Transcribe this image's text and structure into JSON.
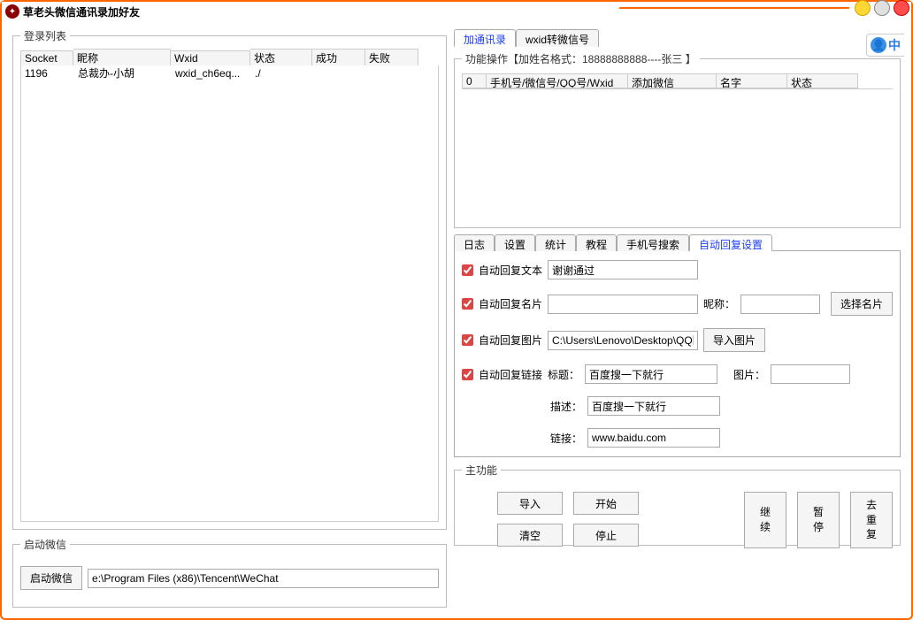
{
  "window": {
    "title": "草老头微信通讯录加好友"
  },
  "left": {
    "login_list_legend": "登录列表",
    "columns": {
      "socket": "Socket",
      "nick": "眤称",
      "wxid": "Wxid",
      "status": "状态",
      "success": "成功",
      "fail": "失败"
    },
    "rows": [
      {
        "socket": "1196",
        "nick": "总裁办-小胡",
        "wxid": "wxid_ch6eq...",
        "status": "./",
        "success": "",
        "fail": ""
      }
    ],
    "start_wechat_legend": "启动微信",
    "start_wechat_btn": "启动微信",
    "wechat_path": "e:\\Program Files (x86)\\Tencent\\WeChat"
  },
  "right": {
    "top_tabs": {
      "contacts": "加通讯录",
      "wxid_convert": "wxid转微信号"
    },
    "op_legend": "功能操作【加姓名格式：18888888888----张三 】",
    "op_columns": {
      "idx": "0",
      "phone": "手机号/微信号/QQ号/Wxid",
      "add": "添加微信",
      "name": "名字",
      "status": "状态"
    },
    "sub_tabs": {
      "log": "日志",
      "settings": "设置",
      "stats": "统计",
      "tutorial": "教程",
      "phone_search": "手机号搜索",
      "autoreply": "自动回复设置"
    },
    "autoreply": {
      "text_chk": "自动回复文本",
      "text_val": "谢谢通过",
      "card_chk": "自动回复名片",
      "card_val": "",
      "nick_label": "昵称：",
      "nick_val": "",
      "select_card_btn": "选择名片",
      "img_chk": "自动回复图片",
      "img_path": "C:\\Users\\Lenovo\\Desktop\\QQ图",
      "import_img_btn": "导入图片",
      "link_chk": "自动回复链接",
      "link_title_label": "标题：",
      "link_title_val": "百度搜一下就行",
      "link_img_label": "图片：",
      "link_img_val": "",
      "link_desc_label": "描述：",
      "link_desc_val": "百度搜一下就行",
      "link_url_label": "链接：",
      "link_url_val": "www.baidu.com"
    },
    "main_funcs_legend": "主功能",
    "buttons": {
      "import": "导入",
      "clear": "清空",
      "start": "开始",
      "stop": "停止",
      "continue": "继\n续",
      "pause": "暂\n停",
      "dedupe": "去\n重\n复"
    },
    "ime": "中"
  }
}
